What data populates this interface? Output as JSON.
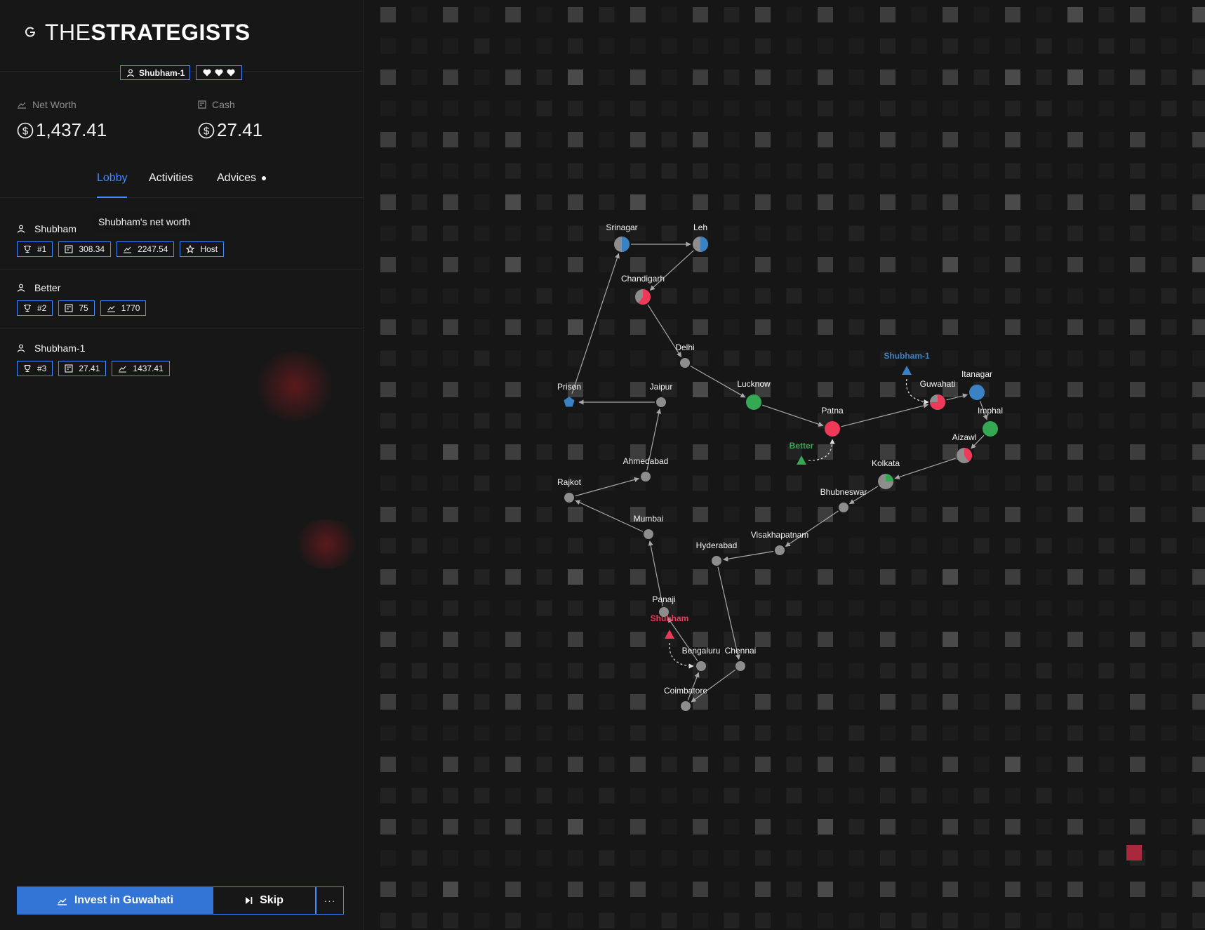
{
  "brand": {
    "light": "THE",
    "bold": "STRATEGISTS"
  },
  "header": {
    "player": "Shubham-1",
    "lives": 3
  },
  "stats": {
    "net_worth_label": "Net Worth",
    "net_worth_value": "1,437.41",
    "cash_label": "Cash",
    "cash_value": "27.41"
  },
  "tabs": [
    {
      "label": "Lobby",
      "active": true
    },
    {
      "label": "Activities",
      "active": false
    },
    {
      "label": "Advices",
      "active": false,
      "notification": true
    }
  ],
  "tooltip": "Shubham's net worth",
  "players": [
    {
      "name": "Shubham",
      "rank": "#1",
      "cash": "308.34",
      "net_worth": "2247.54",
      "host": "Host"
    },
    {
      "name": "Better",
      "rank": "#2",
      "cash": "75",
      "net_worth": "1770"
    },
    {
      "name": "Shubham-1",
      "rank": "#3",
      "cash": "27.41",
      "net_worth": "1437.41"
    }
  ],
  "actions": {
    "invest_label": "Invest in Guwahati",
    "skip_label": "Skip",
    "more_label": "···"
  },
  "colors": {
    "accent": "#4589ff",
    "invest_button": "#3375d6",
    "red": "#ee3a58",
    "green": "#34a853",
    "blue": "#3b82c4",
    "grey_node": "#8d8d8d"
  },
  "map": {
    "cities": [
      {
        "name": "Srinagar",
        "type": "pie",
        "fill": "blue",
        "share": 0.5
      },
      {
        "name": "Leh",
        "type": "pie",
        "fill": "blue",
        "share": 0.5
      },
      {
        "name": "Chandigarh",
        "type": "pie",
        "fill": "red",
        "share": 0.6
      },
      {
        "name": "Delhi",
        "type": "plain"
      },
      {
        "name": "Prison",
        "type": "prison"
      },
      {
        "name": "Jaipur",
        "type": "plain"
      },
      {
        "name": "Lucknow",
        "type": "full",
        "fill": "green"
      },
      {
        "name": "Patna",
        "type": "full",
        "fill": "red"
      },
      {
        "name": "Guwahati",
        "type": "pie",
        "fill": "red",
        "share": 0.75
      },
      {
        "name": "Itanagar",
        "type": "full",
        "fill": "blue"
      },
      {
        "name": "Imphal",
        "type": "full",
        "fill": "green"
      },
      {
        "name": "Aizawl",
        "type": "pie",
        "fill": "red",
        "share": 0.4
      },
      {
        "name": "Kolkata",
        "type": "pie",
        "fill": "green",
        "share": 0.25
      },
      {
        "name": "Bhubneswar",
        "type": "plain"
      },
      {
        "name": "Visakhapatnam",
        "type": "plain"
      },
      {
        "name": "Hyderabad",
        "type": "plain"
      },
      {
        "name": "Ahmedabad",
        "type": "plain"
      },
      {
        "name": "Rajkot",
        "type": "plain"
      },
      {
        "name": "Mumbai",
        "type": "plain"
      },
      {
        "name": "Panaji",
        "type": "plain"
      },
      {
        "name": "Bengaluru",
        "type": "plain"
      },
      {
        "name": "Chennai",
        "type": "plain"
      },
      {
        "name": "Coimbatore",
        "type": "plain"
      }
    ],
    "routes": [
      [
        "Srinagar",
        "Leh"
      ],
      [
        "Leh",
        "Chandigarh"
      ],
      [
        "Chandigarh",
        "Delhi"
      ],
      [
        "Delhi",
        "Lucknow"
      ],
      [
        "Lucknow",
        "Patna"
      ],
      [
        "Patna",
        "Guwahati"
      ],
      [
        "Guwahati",
        "Itanagar"
      ],
      [
        "Itanagar",
        "Imphal"
      ],
      [
        "Imphal",
        "Aizawl"
      ],
      [
        "Aizawl",
        "Kolkata"
      ],
      [
        "Kolkata",
        "Bhubneswar"
      ],
      [
        "Bhubneswar",
        "Visakhapatnam"
      ],
      [
        "Visakhapatnam",
        "Hyderabad"
      ],
      [
        "Hyderabad",
        "Chennai"
      ],
      [
        "Chennai",
        "Coimbatore"
      ],
      [
        "Coimbatore",
        "Bengaluru"
      ],
      [
        "Bengaluru",
        "Panaji"
      ],
      [
        "Panaji",
        "Mumbai"
      ],
      [
        "Mumbai",
        "Rajkot"
      ],
      [
        "Rajkot",
        "Ahmedabad"
      ],
      [
        "Ahmedabad",
        "Jaipur"
      ],
      [
        "Jaipur",
        "Prison"
      ],
      [
        "Prison",
        "Srinagar"
      ]
    ],
    "tokens": [
      {
        "player": "Shubham-1",
        "city": "Guwahati",
        "color": "blue"
      },
      {
        "player": "Better",
        "city": "Patna",
        "color": "green"
      },
      {
        "player": "Shubham",
        "city": "Bengaluru",
        "color": "red"
      }
    ]
  }
}
